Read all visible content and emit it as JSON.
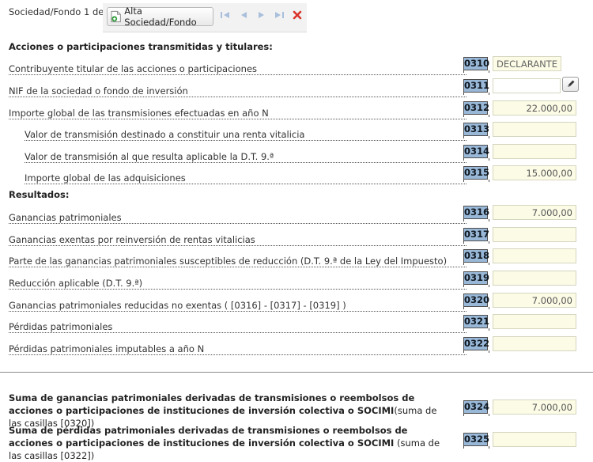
{
  "header": {
    "counter": "Sociedad/Fondo 1 de 1",
    "alta_label": "Alta Sociedad/Fondo"
  },
  "sections": {
    "acciones": "Acciones o participaciones transmitidas y titulares:",
    "resultados": "Resultados:"
  },
  "rows": [
    {
      "label": "Contribuyente titular de las acciones o participaciones",
      "code": "0310",
      "value": "DECLARANTE"
    },
    {
      "label": "NIF de la sociedad o fondo de inversión",
      "code": "0311",
      "value": ""
    },
    {
      "label": "Importe global de las transmisiones efectuadas en año N",
      "code": "0312",
      "value": "22.000,00"
    },
    {
      "label": "Valor de transmisión destinado a constituir una renta vitalicia",
      "code": "0313",
      "value": ""
    },
    {
      "label": "Valor de transmisión al que resulta aplicable la D.T. 9.ª",
      "code": "0314",
      "value": ""
    },
    {
      "label": "Importe global de las adquisiciones",
      "code": "0315",
      "value": "15.000,00"
    },
    {
      "label": "Ganancias patrimoniales",
      "code": "0316",
      "value": "7.000,00"
    },
    {
      "label": "Ganancias exentas por reinversión de rentas vitalicias",
      "code": "0317",
      "value": ""
    },
    {
      "label": "Parte de las ganancias patrimoniales susceptibles de reducción (D.T. 9.ª de la Ley del Impuesto)",
      "code": "0318",
      "value": ""
    },
    {
      "label": "Reducción aplicable (D.T. 9.ª)",
      "code": "0319",
      "value": ""
    },
    {
      "label": "Ganancias patrimoniales reducidas no exentas ( [0316] - [0317] - [0319] )",
      "code": "0320",
      "value": "7.000,00"
    },
    {
      "label": "Pérdidas patrimoniales",
      "code": "0321",
      "value": ""
    },
    {
      "label": "Pérdidas patrimoniales imputables a año N",
      "code": "0322",
      "value": ""
    }
  ],
  "summary": [
    {
      "bold": "Suma de ganancias patrimoniales derivadas de transmisiones o reembolsos de acciones o participaciones de instituciones de inversión colectiva o SOCIMI",
      "note": "(suma de las casillas [0320])",
      "code": "0324",
      "value": "7.000,00"
    },
    {
      "bold": "Suma de pérdidas patrimoniales derivadas de transmisiones o reembolsos de acciones o participaciones de instituciones de inversión colectiva o SOCIMI",
      "note": " (suma de las casillas [0322])",
      "code": "0325",
      "value": ""
    }
  ]
}
